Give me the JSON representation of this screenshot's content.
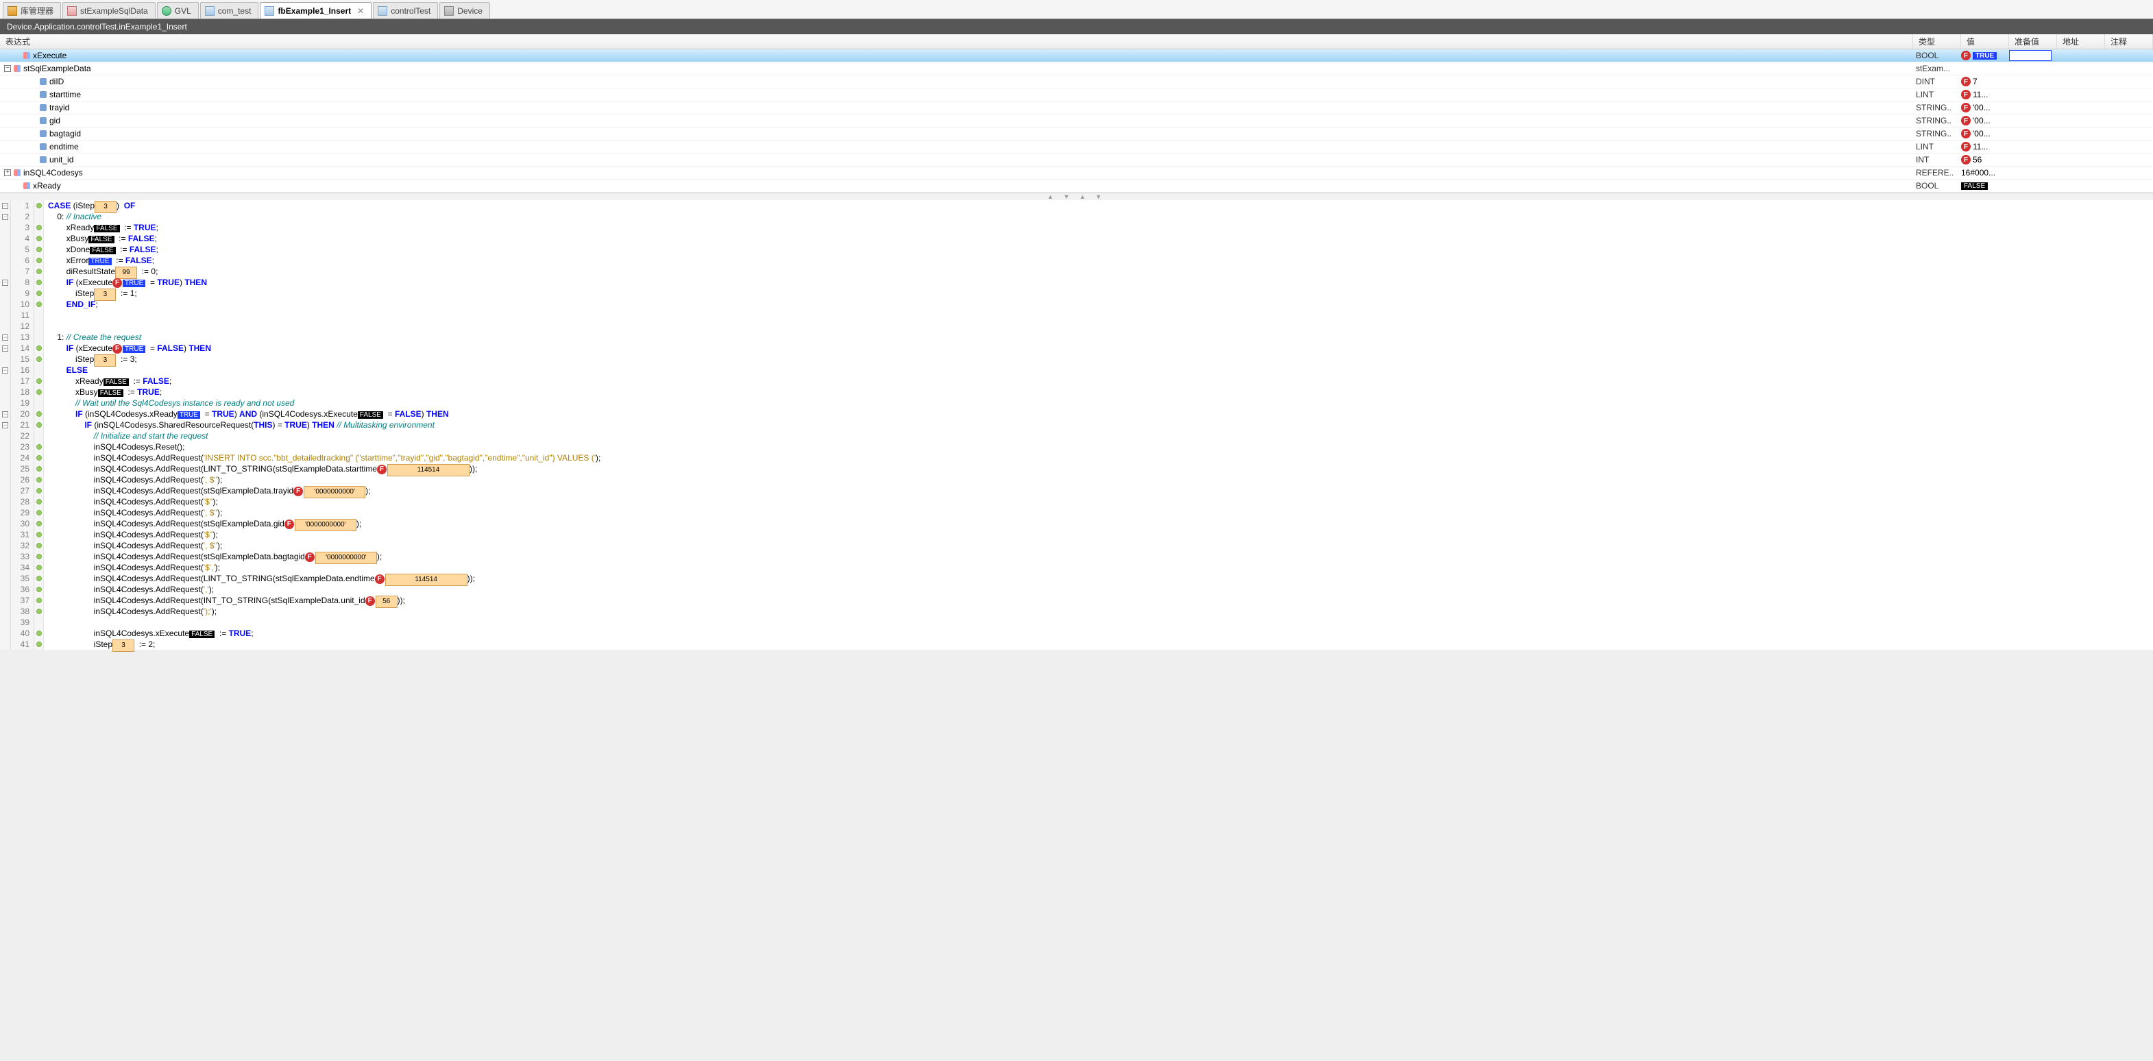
{
  "tabs": [
    {
      "icon": "ico-lib",
      "label": "库管理器"
    },
    {
      "icon": "ico-st",
      "label": "stExampleSqlData"
    },
    {
      "icon": "ico-gvl",
      "label": "GVL"
    },
    {
      "icon": "ico-pou",
      "label": "com_test"
    },
    {
      "icon": "ico-fb",
      "label": "fbExample1_Insert"
    },
    {
      "icon": "ico-pou",
      "label": "controlTest"
    },
    {
      "icon": "ico-dev",
      "label": "Device"
    }
  ],
  "active_tab": 4,
  "path": "Device.Application.controlTest.inExample1_Insert",
  "var_header": {
    "expr": "表达式",
    "type": "类型",
    "val": "值",
    "prep": "准备值",
    "addr": "地址",
    "comm": "注释"
  },
  "vars": [
    {
      "sel": true,
      "tog": null,
      "depth": 0,
      "icon": "io",
      "name": "xExecute",
      "type": "BOOL",
      "fred": true,
      "chip": "TRUE",
      "prep_edit": true
    },
    {
      "sel": false,
      "tog": "-",
      "depth": 0,
      "icon": "io",
      "name": "stSqlExampleData",
      "type": "stExam...",
      "val": ""
    },
    {
      "sel": false,
      "depth": 1,
      "icon": "mem",
      "name": "diID",
      "type": "DINT",
      "fred": true,
      "val": "7"
    },
    {
      "sel": false,
      "depth": 1,
      "icon": "mem",
      "name": "starttime",
      "type": "LINT",
      "fred": true,
      "val": "11..."
    },
    {
      "sel": false,
      "depth": 1,
      "icon": "mem",
      "name": "trayid",
      "type": "STRING..",
      "fred": true,
      "val": "'00..."
    },
    {
      "sel": false,
      "depth": 1,
      "icon": "mem",
      "name": "gid",
      "type": "STRING..",
      "fred": true,
      "val": "'00..."
    },
    {
      "sel": false,
      "depth": 1,
      "icon": "mem",
      "name": "bagtagid",
      "type": "STRING..",
      "fred": true,
      "val": "'00..."
    },
    {
      "sel": false,
      "depth": 1,
      "icon": "mem",
      "name": "endtime",
      "type": "LINT",
      "fred": true,
      "val": "11..."
    },
    {
      "sel": false,
      "depth": 1,
      "icon": "mem",
      "name": "unit_id",
      "type": "INT",
      "fred": true,
      "val": "56"
    },
    {
      "sel": false,
      "tog": "+",
      "depth": 0,
      "icon": "io",
      "name": "inSQL4Codesys",
      "type": "REFERE..",
      "val": "16#000..."
    },
    {
      "sel": false,
      "depth": 0,
      "icon": "io",
      "name": "xReady",
      "type": "BOOL",
      "chip": "FALSE"
    }
  ],
  "code": {
    "mon": {
      "iStep": "3",
      "xReady": "FALSE",
      "xBusy": "FALSE",
      "xDone": "FALSE",
      "xError": "TRUE",
      "diResultState": "99",
      "xExecute": "TRUE",
      "codesys_xReady": "TRUE",
      "codesys_xExecute": "FALSE",
      "codesys_xExecute2": "FALSE",
      "starttime": "114514",
      "trayid": "'0000000000'",
      "gid": "'0000000000'",
      "bagtagid": "'0000000000'",
      "endtime": "114514",
      "unit_id": "56"
    },
    "lines": [
      {
        "n": 1,
        "fold": "-",
        "mark": true,
        "html": "<span class='kw'>CASE</span> (iStep<span class='mv' data-bind='code.mon.iStep'></span>)  <span class='kw'>OF</span>"
      },
      {
        "n": 2,
        "fold": "-",
        "mark": false,
        "html": "    0: <span class='cmt'>// Inactive</span>"
      },
      {
        "n": 3,
        "mark": true,
        "html": "        xReady<span class='mon-f' data-bind='code.mon.xReady'></span>  := <span class='kw'>TRUE</span>;"
      },
      {
        "n": 4,
        "mark": true,
        "html": "        xBusy<span class='mon-f' data-bind='code.mon.xBusy'></span>  := <span class='kw'>FALSE</span>;"
      },
      {
        "n": 5,
        "mark": true,
        "html": "        xDone<span class='mon-f' data-bind='code.mon.xDone'></span>  := <span class='kw'>FALSE</span>;"
      },
      {
        "n": 6,
        "mark": true,
        "html": "        xError<span class='mon-t' data-bind='code.mon.xError'></span>  := <span class='kw'>FALSE</span>;"
      },
      {
        "n": 7,
        "mark": true,
        "html": "        diResultState<span class='mv' data-bind='code.mon.diResultState'></span>  := 0;"
      },
      {
        "n": 8,
        "fold": "-",
        "mark": true,
        "html": "        <span class='kw'>IF</span> (xExecute<span class='mvF'><span class='fdot'>F</span></span><span class='mon-t' data-bind='code.mon.xExecute'></span>  = <span class='kw'>TRUE</span>) <span class='kw'>THEN</span>"
      },
      {
        "n": 9,
        "mark": true,
        "html": "            iStep<span class='mv' data-bind='code.mon.iStep'></span>  := 1;"
      },
      {
        "n": 10,
        "mark": true,
        "html": "        <span class='kw'>END_IF</span>;"
      },
      {
        "n": 11,
        "html": ""
      },
      {
        "n": 12,
        "html": ""
      },
      {
        "n": 13,
        "fold": "-",
        "mark": false,
        "html": "    1: <span class='cmt'>// Create the request</span>"
      },
      {
        "n": 14,
        "fold": "-",
        "mark": true,
        "html": "        <span class='kw'>IF</span> (xExecute<span class='mvF'><span class='fdot'>F</span></span><span class='mon-t' data-bind='code.mon.xExecute'></span>  = <span class='kw'>FALSE</span>) <span class='kw'>THEN</span>"
      },
      {
        "n": 15,
        "mark": true,
        "html": "            iStep<span class='mv' data-bind='code.mon.iStep'></span>  := 3;"
      },
      {
        "n": 16,
        "fold": "-",
        "mark": false,
        "html": "        <span class='kw'>ELSE</span>"
      },
      {
        "n": 17,
        "mark": true,
        "html": "            xReady<span class='mon-f' data-bind='code.mon.xReady'></span>  := <span class='kw'>FALSE</span>;"
      },
      {
        "n": 18,
        "mark": true,
        "html": "            xBusy<span class='mon-f' data-bind='code.mon.xBusy'></span>  := <span class='kw'>TRUE</span>;"
      },
      {
        "n": 19,
        "mark": false,
        "html": "            <span class='cmt'>// Wait until the Sql4Codesys instance is ready and not used</span>"
      },
      {
        "n": 20,
        "fold": "-",
        "mark": true,
        "html": "            <span class='kw'>IF</span> (inSQL4Codesys.xReady<span class='mon-t' data-bind='code.mon.codesys_xReady'></span>  = <span class='kw'>TRUE</span>) <span class='kw'>AND</span> (inSQL4Codesys.xExecute<span class='mon-f' data-bind='code.mon.codesys_xExecute'></span>  = <span class='kw'>FALSE</span>) <span class='kw'>THEN</span>"
      },
      {
        "n": 21,
        "fold": "-",
        "mark": true,
        "html": "                <span class='kw'>IF</span> (inSQL4Codesys.SharedResourceRequest(<span class='kw'>THIS</span>) = <span class='kw'>TRUE</span>) <span class='kw'>THEN</span> <span class='cmt'>// Multitasking environment</span>"
      },
      {
        "n": 22,
        "mark": false,
        "html": "                    <span class='cmt'>// Initialize and start the request</span>"
      },
      {
        "n": 23,
        "mark": true,
        "html": "                    inSQL4Codesys.Reset();"
      },
      {
        "n": 24,
        "mark": true,
        "html": "                    inSQL4Codesys.AddRequest(<span class='str'>'INSERT INTO scc.\"bbt_detailedtracking\" (\"starttime\",\"trayid\",\"gid\",\"bagtagid\",\"endtime\",\"unit_id\") VALUES ('</span>);"
      },
      {
        "n": 25,
        "mark": true,
        "html": "                    inSQL4Codesys.AddRequest(LINT_TO_STRING(stSqlExampleData.starttime<span class='mvF'><span class='fdot'>F</span></span><span class='mv mv-xlong' data-bind='code.mon.starttime'></span>));"
      },
      {
        "n": 26,
        "mark": true,
        "html": "                    inSQL4Codesys.AddRequest(<span class='str'>', $''</span>);"
      },
      {
        "n": 27,
        "mark": true,
        "html": "                    inSQL4Codesys.AddRequest(stSqlExampleData.trayid<span class='mvF'><span class='fdot'>F</span></span><span class='mv mv-long' data-bind='code.mon.trayid'></span>);"
      },
      {
        "n": 28,
        "mark": true,
        "html": "                    inSQL4Codesys.AddRequest(<span class='str'>'$''</span>);"
      },
      {
        "n": 29,
        "mark": true,
        "html": "                    inSQL4Codesys.AddRequest(<span class='str'>', $''</span>);"
      },
      {
        "n": 30,
        "mark": true,
        "html": "                    inSQL4Codesys.AddRequest(stSqlExampleData.gid<span class='mvF'><span class='fdot'>F</span></span><span class='mv mv-long' data-bind='code.mon.gid'></span>);"
      },
      {
        "n": 31,
        "mark": true,
        "html": "                    inSQL4Codesys.AddRequest(<span class='str'>'$''</span>);"
      },
      {
        "n": 32,
        "mark": true,
        "html": "                    inSQL4Codesys.AddRequest(<span class='str'>', $''</span>);"
      },
      {
        "n": 33,
        "mark": true,
        "html": "                    inSQL4Codesys.AddRequest(stSqlExampleData.bagtagid<span class='mvF'><span class='fdot'>F</span></span><span class='mv mv-long' data-bind='code.mon.bagtagid'></span>);"
      },
      {
        "n": 34,
        "mark": true,
        "html": "                    inSQL4Codesys.AddRequest(<span class='str'>'$','</span>);"
      },
      {
        "n": 35,
        "mark": true,
        "html": "                    inSQL4Codesys.AddRequest(LINT_TO_STRING(stSqlExampleData.endtime<span class='mvF'><span class='fdot'>F</span></span><span class='mv mv-xlong' data-bind='code.mon.endtime'></span>));"
      },
      {
        "n": 36,
        "mark": true,
        "html": "                    inSQL4Codesys.AddRequest(<span class='str'>','</span>);"
      },
      {
        "n": 37,
        "mark": true,
        "html": "                    inSQL4Codesys.AddRequest(INT_TO_STRING(stSqlExampleData.unit_id<span class='mvF'><span class='fdot'>F</span></span><span class='mv' data-bind='code.mon.unit_id'></span>));"
      },
      {
        "n": 38,
        "mark": true,
        "html": "                    inSQL4Codesys.AddRequest(<span class='str'>');'</span>);"
      },
      {
        "n": 39,
        "html": ""
      },
      {
        "n": 40,
        "mark": true,
        "html": "                    inSQL4Codesys.xExecute<span class='mon-f' data-bind='code.mon.codesys_xExecute2'></span>  := <span class='kw'>TRUE</span>;"
      },
      {
        "n": 41,
        "mark": true,
        "html": "                    iStep<span class='mv' data-bind='code.mon.iStep'></span>  := 2;"
      }
    ]
  }
}
